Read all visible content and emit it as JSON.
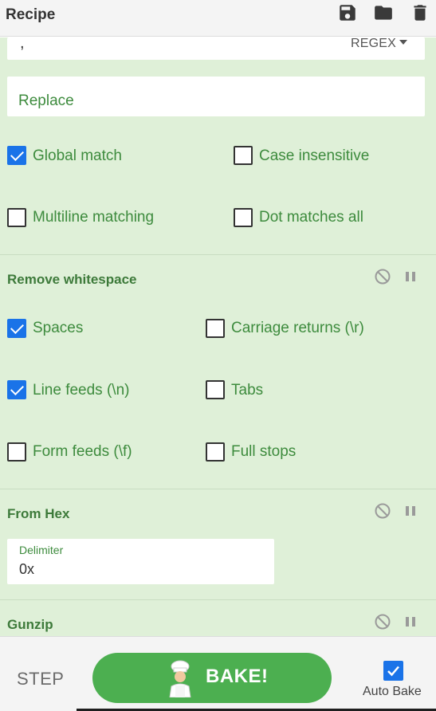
{
  "header": {
    "title": "Recipe",
    "icons": [
      "save-icon",
      "folder-icon",
      "trash-icon"
    ]
  },
  "find_replace": {
    "find_value": ",",
    "find_type": "REGEX",
    "replace_placeholder": "Replace",
    "options": [
      {
        "label": "Global match",
        "checked": true
      },
      {
        "label": "Case insensitive",
        "checked": false
      },
      {
        "label": "Multiline matching",
        "checked": false
      },
      {
        "label": "Dot matches all",
        "checked": false
      }
    ]
  },
  "remove_whitespace": {
    "title": "Remove whitespace",
    "options": [
      {
        "label": "Spaces",
        "checked": true
      },
      {
        "label": "Carriage returns (\\r)",
        "checked": false
      },
      {
        "label": "Line feeds (\\n)",
        "checked": true
      },
      {
        "label": "Tabs",
        "checked": false
      },
      {
        "label": "Form feeds (\\f)",
        "checked": false
      },
      {
        "label": "Full stops",
        "checked": false
      }
    ]
  },
  "from_hex": {
    "title": "From Hex",
    "delimiter_label": "Delimiter",
    "delimiter_value": "0x"
  },
  "gunzip": {
    "title": "Gunzip"
  },
  "footer": {
    "step_label": "STEP",
    "bake_label": "BAKE!",
    "auto_bake_label": "Auto Bake",
    "auto_bake_checked": true
  },
  "colors": {
    "recipe_bg": "#dff0d8",
    "label_green": "#3d8b3d",
    "checkbox_blue": "#1a73e8",
    "bake_green": "#4caf50"
  }
}
